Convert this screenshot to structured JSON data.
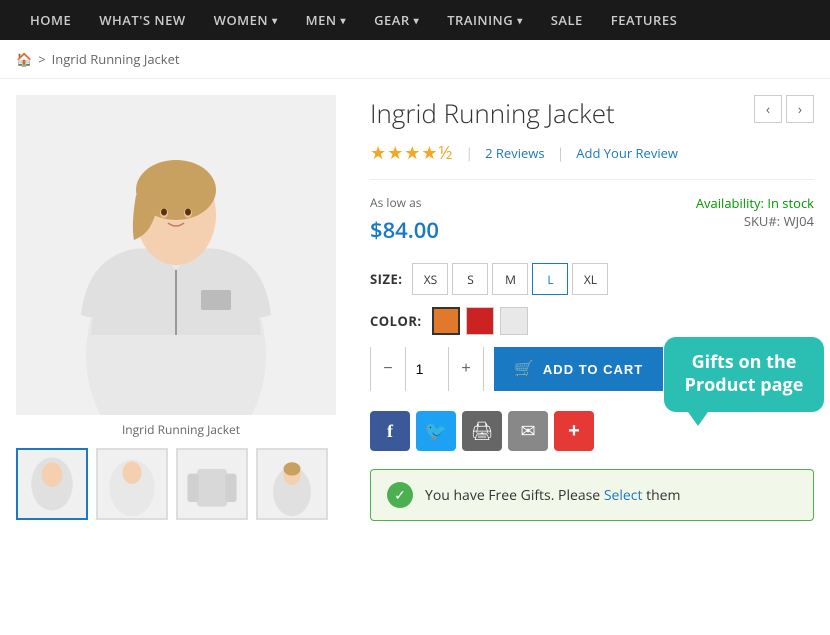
{
  "nav": {
    "items": [
      {
        "label": "HOME",
        "hasChevron": false
      },
      {
        "label": "WHAT'S NEW",
        "hasChevron": false
      },
      {
        "label": "WOMEN",
        "hasChevron": true
      },
      {
        "label": "MEN",
        "hasChevron": true
      },
      {
        "label": "GEAR",
        "hasChevron": true
      },
      {
        "label": "TRAINING",
        "hasChevron": true
      },
      {
        "label": "SALE",
        "hasChevron": false
      },
      {
        "label": "FEATURES",
        "hasChevron": false
      }
    ]
  },
  "breadcrumb": {
    "home_label": "🏠",
    "separator": ">",
    "current": "Ingrid Running Jacket"
  },
  "product": {
    "title": "Ingrid Running Jacket",
    "stars": "★★★★½",
    "review_count": "2",
    "reviews_label": "Reviews",
    "add_review_label": "Add Your Review",
    "as_low_as": "As low as",
    "price": "$84.00",
    "availability_label": "Availability:",
    "availability_value": "In stock",
    "sku_label": "SKU#:",
    "sku_value": "WJ04",
    "size_label": "SIZE:",
    "sizes": [
      "XS",
      "S",
      "M",
      "L",
      "XL"
    ],
    "color_label": "COLOR:",
    "colors": [
      {
        "hex": "#e07a2a",
        "label": "Orange"
      },
      {
        "hex": "#cc2222",
        "label": "Red"
      },
      {
        "hex": "#e8e8e8",
        "label": "White"
      }
    ],
    "qty_value": "1",
    "add_to_cart_label": "ADD TO CART",
    "image_label": "Ingrid Running Jacket",
    "thumbnail_count": 4
  },
  "tooltip": {
    "text": "Gifts on the Product page"
  },
  "social": {
    "buttons": [
      {
        "label": "f",
        "class": "fb",
        "name": "facebook"
      },
      {
        "label": "🐦",
        "class": "tw",
        "name": "twitter"
      },
      {
        "label": "🖨",
        "class": "print",
        "name": "print"
      },
      {
        "label": "✉",
        "class": "email",
        "name": "email"
      },
      {
        "label": "+",
        "class": "plus",
        "name": "more"
      }
    ]
  },
  "free_gifts": {
    "text": "You have Free Gifts. Please",
    "select_label": "Select",
    "after_text": "them"
  }
}
